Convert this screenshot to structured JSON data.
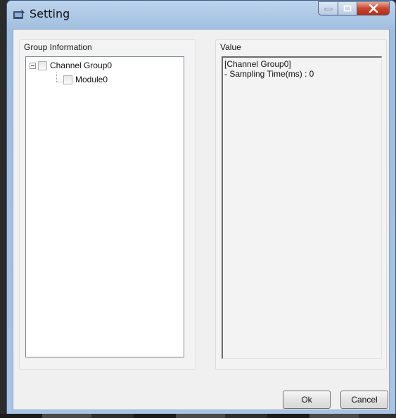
{
  "window": {
    "title": "Setting",
    "icon": "settings-app-icon",
    "caption_buttons": [
      "minimize-icon",
      "maximize-icon",
      "close-icon"
    ]
  },
  "group_info": {
    "caption": "Group Information",
    "tree": [
      {
        "label": "Channel Group0",
        "expanded": true,
        "checked": false
      },
      {
        "label": "Module0",
        "checked": false
      }
    ]
  },
  "value_panel": {
    "caption": "Value",
    "lines": [
      "[Channel Group0]",
      "- Sampling Time(ms) : 0"
    ]
  },
  "buttons": {
    "ok": "Ok",
    "cancel": "Cancel"
  },
  "colors": {
    "close_button": "#c9452d",
    "title_bar": "#9fbddf"
  }
}
